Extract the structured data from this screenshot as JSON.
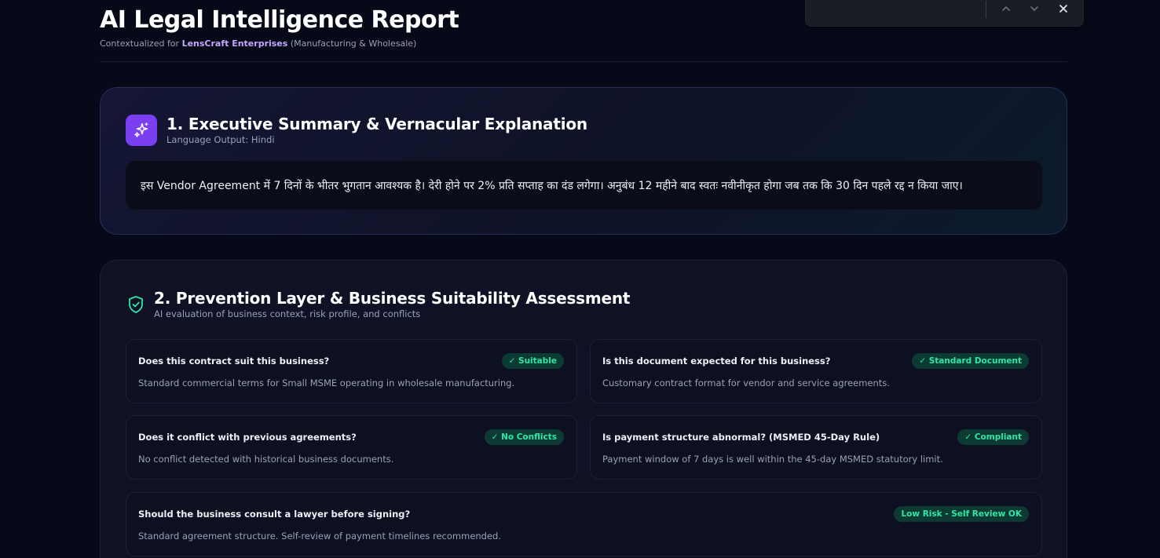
{
  "header": {
    "title": "AI Legal Intelligence Report",
    "subtitle_prefix": "Contextualized for",
    "company": "LensCraft Enterprises",
    "industry": "(Manufacturing & Wholesale)"
  },
  "find_bar": {
    "prev_icon": "chevron-up-icon",
    "next_icon": "chevron-down-icon",
    "close_icon": "close-icon"
  },
  "summary": {
    "title": "1. Executive Summary & Vernacular Explanation",
    "subtitle": "Language Output: Hindi",
    "icon": "sparkle-icon",
    "explanation": "इस Vendor Agreement में 7 दिनों के भीतर भुगतान आवश्यक है। देरी होने पर 2% प्रति सप्ताह का दंड लगेगा। अनुबंध 12 महीने बाद स्वतः नवीनीकृत होगा जब तक कि 30 दिन पहले रद्द न किया जाए।"
  },
  "prevention": {
    "title": "2. Prevention Layer & Business Suitability Assessment",
    "subtitle": "AI evaluation of business context, risk profile, and conflicts",
    "icon": "shield-check-icon",
    "items": [
      {
        "question": "Does this contract suit this business?",
        "badge": "✓ Suitable",
        "answer": "Standard commercial terms for Small MSME operating in wholesale manufacturing."
      },
      {
        "question": "Is this document expected for this business?",
        "badge": "✓ Standard Document",
        "answer": "Customary contract format for vendor and service agreements."
      },
      {
        "question": "Does it conflict with previous agreements?",
        "badge": "✓ No Conflicts",
        "answer": "No conflict detected with historical business documents."
      },
      {
        "question": "Is payment structure abnormal? (MSMED 45-Day Rule)",
        "badge": "✓ Compliant",
        "answer": "Payment window of 7 days is well within the 45-day MSMED statutory limit."
      },
      {
        "question": "Should the business consult a lawyer before signing?",
        "badge": "Low Risk - Self Review OK",
        "answer": "Standard agreement structure. Self-review of payment timelines recommended."
      }
    ]
  },
  "colors": {
    "background": "#060918",
    "accent_purple": "#7b3ff2",
    "company_text": "#c4a8ff",
    "success_green": "#2ee6a6",
    "badge_bg": "#0d3b33"
  }
}
